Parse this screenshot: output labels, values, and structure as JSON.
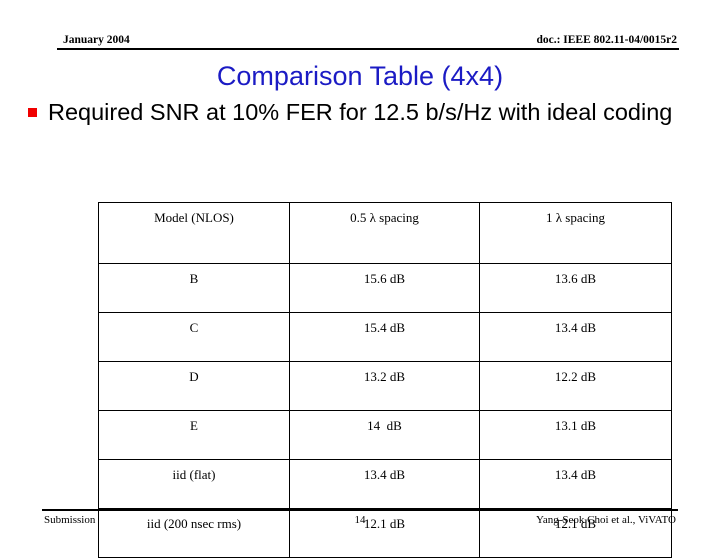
{
  "slide": {
    "header": {
      "left": "January 2004",
      "right": "doc.: IEEE 802.11-04/0015r2"
    },
    "title": "Comparison Table (4x4)",
    "bullets": [
      {
        "marker": "red-square-bullet",
        "text": "Required SNR at 10% FER for 12.5 b/s/Hz with ideal coding"
      }
    ],
    "footer": {
      "left": "Submission",
      "center": "14",
      "right": "Yang-Seok Choi et al., ViVATO"
    },
    "colors": {
      "title": "#1B1BC4",
      "bullet_marker": "#F00000",
      "text": "#000000",
      "rule": "#000000"
    }
  },
  "table": {
    "columns": [
      "Model (NLOS)",
      "0.5 λ spacing",
      "1 λ spacing"
    ],
    "rows": [
      {
        "model": "B",
        "sp_half_lambda": "15.6 dB",
        "sp_one_lambda": "13.6 dB"
      },
      {
        "model": "C",
        "sp_half_lambda": "15.4 dB",
        "sp_one_lambda": "13.4 dB"
      },
      {
        "model": "D",
        "sp_half_lambda": "13.2 dB",
        "sp_one_lambda": "12.2 dB"
      },
      {
        "model": "E",
        "sp_half_lambda": "14  dB",
        "sp_one_lambda": "13.1 dB"
      },
      {
        "model": "iid (flat)",
        "sp_half_lambda": "13.4 dB",
        "sp_one_lambda": "13.4 dB"
      },
      {
        "model": "iid (200 nsec rms)",
        "sp_half_lambda": "12.1 dB",
        "sp_one_lambda": "12.1 dB"
      }
    ]
  }
}
